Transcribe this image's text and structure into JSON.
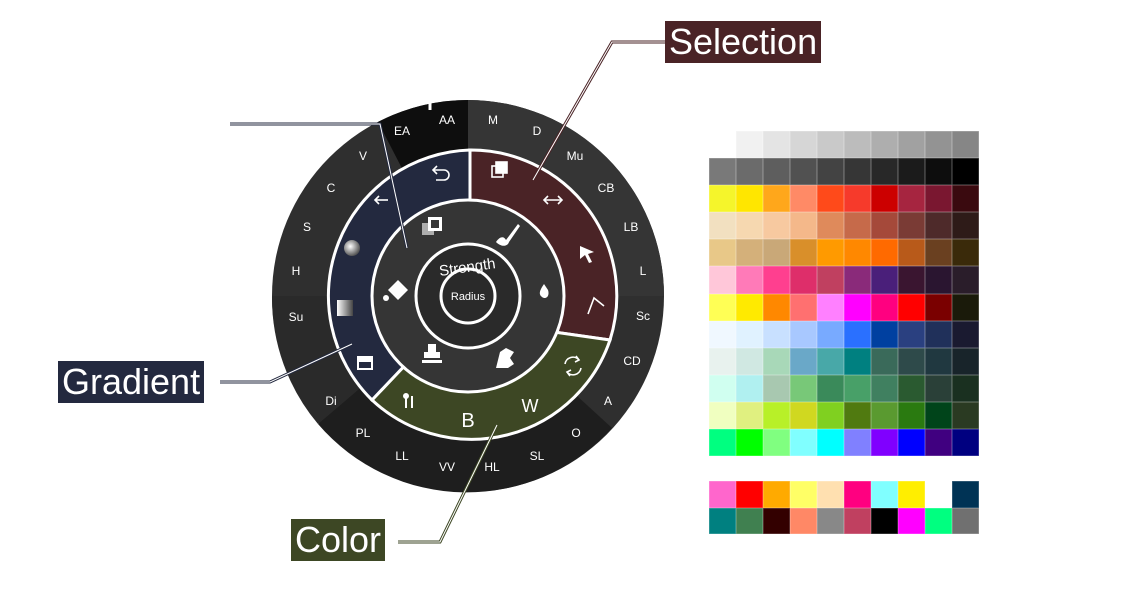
{
  "callouts": {
    "selection": "Selection",
    "gradient": "Gradient",
    "color": "Color"
  },
  "center": {
    "strength": "Strength",
    "radius": "Radius"
  },
  "outer_ring": [
    "M",
    "D",
    "Mu",
    "CB",
    "LB",
    "L",
    "Sc",
    "CD",
    "A",
    "O",
    "SL",
    "HL",
    "VV",
    "LL",
    "PL",
    "Di",
    "Su",
    "H",
    "S",
    "C",
    "V",
    "EA",
    "AA"
  ],
  "middle_ring": {
    "selection_icons": [
      "copy-icon",
      "resize-arrows-icon",
      "pointer-icon",
      "lasso-icon"
    ],
    "color_labels": [
      "B",
      "W"
    ],
    "color_icons": [
      "swap-icon",
      "color-picker-icon"
    ],
    "gradient_icons": [
      "undo-icon",
      "arrow-left-icon",
      "radial-gradient-icon",
      "linear-gradient-icon",
      "pattern-icon"
    ]
  },
  "inner_ring": {
    "tool_icons": [
      "brush-icon",
      "drop-icon",
      "smudge-icon",
      "stamp-icon",
      "fill-bucket-icon",
      "layer-icon"
    ]
  },
  "colors": {
    "wheel_outer": "#2f2f2f",
    "wheel_outer_dark": "#1b1b1b",
    "selection": "#4a2326",
    "gradient": "#23293f",
    "color": "#3d4724",
    "inner": "#353535"
  },
  "palette": [
    [
      "#ffffff",
      "#f1f1f1",
      "#e4e4e4",
      "#d6d6d6",
      "#c9c9c9",
      "#bcbcbc",
      "#aeaeae",
      "#a1a1a1",
      "#939393",
      "#868686"
    ],
    [
      "#797979",
      "#6b6b6b",
      "#5e5e5e",
      "#515151",
      "#434343",
      "#363636",
      "#282828",
      "#1b1b1b",
      "#0d0d0d",
      "#000000"
    ],
    [
      "#f5f52b",
      "#ffe600",
      "#ffa71b",
      "#ff8a66",
      "#ff4a1a",
      "#f63a2b",
      "#cc0000",
      "#a62540",
      "#7a1730",
      "#3a0a0f"
    ],
    [
      "#f2e0c0",
      "#f6d8b0",
      "#f7c9a0",
      "#f4b88a",
      "#df8a5b",
      "#c66a4a",
      "#a5493a",
      "#7a3b35",
      "#4e2a2a",
      "#2e1b18"
    ],
    [
      "#e8c888",
      "#d4b07a",
      "#c9a878",
      "#d98f2a",
      "#ff9a00",
      "#ff8800",
      "#ff6a00",
      "#b85a1a",
      "#6a4020",
      "#3a2a0a"
    ],
    [
      "#ffc7d9",
      "#ff7ab8",
      "#ff3f8f",
      "#de2e6a",
      "#c04060",
      "#8a2a7a",
      "#4a1f7a",
      "#3a1530",
      "#2a1530",
      "#2a1d2a"
    ],
    [
      "#ffff55",
      "#ffea00",
      "#ff8800",
      "#ff7070",
      "#ff80ff",
      "#ff00ff",
      "#ff0080",
      "#ff0000",
      "#7a0000",
      "#1a1a0a"
    ],
    [
      "#f0f8ff",
      "#e0f2ff",
      "#c8e0ff",
      "#a8c8ff",
      "#78aaff",
      "#2a70ff",
      "#0040a0",
      "#2a4080",
      "#20305a",
      "#1a1a30"
    ],
    [
      "#e8f2ee",
      "#d0e8e2",
      "#a8d8b8",
      "#6aa8c8",
      "#48a8a8",
      "#008080",
      "#3a6a5a",
      "#2e4a4a",
      "#203840",
      "#18242a"
    ],
    [
      "#d0fff0",
      "#b0f0f0",
      "#a8c8b0",
      "#78c878",
      "#3a8a5a",
      "#48a068",
      "#408060",
      "#2a5a30",
      "#2a4038",
      "#1a3020"
    ],
    [
      "#f0ffc0",
      "#e0f080",
      "#b8f028",
      "#d0d820",
      "#80d020",
      "#507a10",
      "#5a9a30",
      "#2a7a10",
      "#00441a",
      "#2a3a22"
    ],
    [
      "#00ff80",
      "#00ff00",
      "#80ff80",
      "#80ffff",
      "#00ffff",
      "#8080ff",
      "#8000ff",
      "#0000ff",
      "#400080",
      "#000080"
    ]
  ],
  "recent": [
    [
      "#ff66cc",
      "#ff0000",
      "#ffaa00",
      "#ffff66",
      "#ffe0b0",
      "#ff0080",
      "#80ffff",
      "#ffee00",
      "#ffffff",
      "#003355"
    ],
    [
      "#008080",
      "#408050",
      "#330000",
      "#ff8866",
      "#888888",
      "#c04060",
      "#000000",
      "#ff00ff",
      "#00ff80",
      "#707070"
    ]
  ]
}
